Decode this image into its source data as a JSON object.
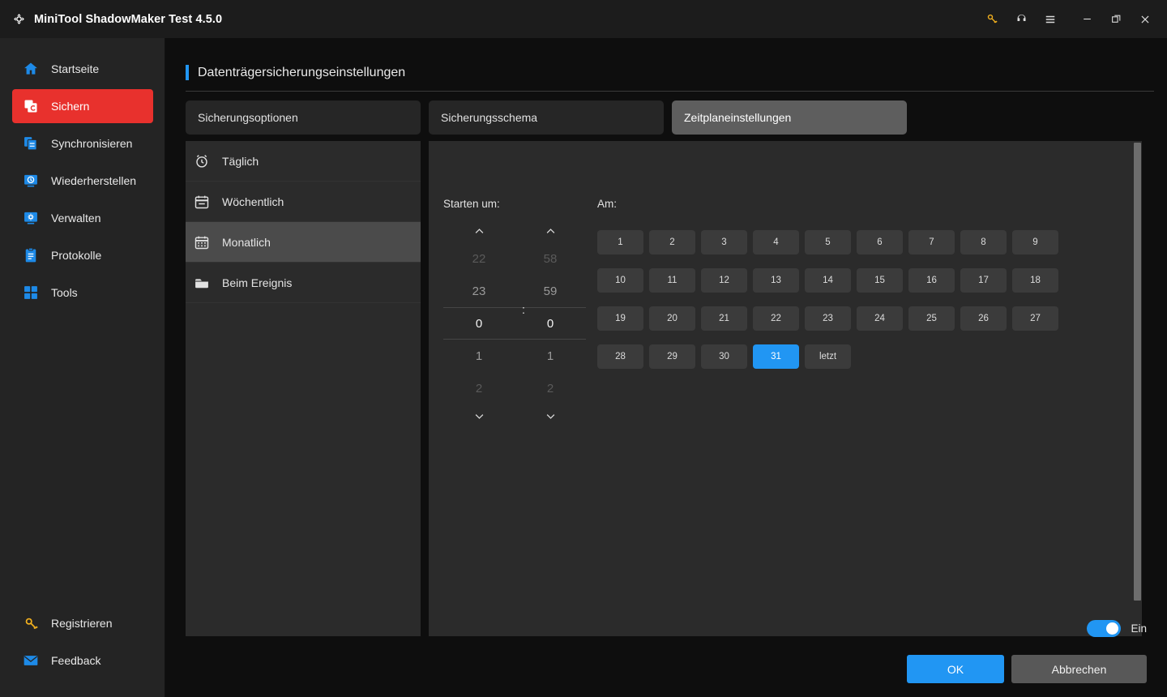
{
  "titlebar": {
    "title": "MiniTool ShadowMaker Test 4.5.0",
    "logo_icon": "shadowmaker-logo-icon",
    "actions": [
      {
        "name": "key-icon",
        "glyph": "key"
      },
      {
        "name": "headset-icon",
        "glyph": "headset"
      },
      {
        "name": "menu-icon",
        "glyph": "menu"
      },
      {
        "name": "minimize-icon",
        "glyph": "minimize"
      },
      {
        "name": "restore-icon",
        "glyph": "restore"
      },
      {
        "name": "close-icon",
        "glyph": "close"
      }
    ]
  },
  "sidebar": {
    "items": [
      {
        "label": "Startseite",
        "icon": "home-icon",
        "active": false
      },
      {
        "label": "Sichern",
        "icon": "backup-icon",
        "active": true
      },
      {
        "label": "Synchronisieren",
        "icon": "sync-icon",
        "active": false
      },
      {
        "label": "Wiederherstellen",
        "icon": "restore-monitor-icon",
        "active": false
      },
      {
        "label": "Verwalten",
        "icon": "manage-gear-monitor-icon",
        "active": false
      },
      {
        "label": "Protokolle",
        "icon": "logs-clipboard-icon",
        "active": false
      },
      {
        "label": "Tools",
        "icon": "tools-grid-icon",
        "active": false
      }
    ],
    "bottom_items": [
      {
        "label": "Registrieren",
        "icon": "key-icon"
      },
      {
        "label": "Feedback",
        "icon": "mail-icon"
      }
    ]
  },
  "main": {
    "page_title": "Datenträgersicherungseinstellungen",
    "accent_color": "#2196f3",
    "tabs": [
      {
        "label": "Sicherungsoptionen",
        "active": false
      },
      {
        "label": "Sicherungsschema",
        "active": false
      },
      {
        "label": "Zeitplaneinstellungen",
        "active": true
      }
    ],
    "schedule_types": [
      {
        "label": "Täglich",
        "icon": "alarm-clock-icon",
        "active": false
      },
      {
        "label": "Wöchentlich",
        "icon": "calendar-icon",
        "active": false
      },
      {
        "label": "Monatlich",
        "icon": "calendar-grid-icon",
        "active": true
      },
      {
        "label": "Beim Ereignis",
        "icon": "folder-icon",
        "active": false
      }
    ],
    "time_picker": {
      "label": "Starten um:",
      "separator": ":",
      "up_icon": "chevron-up-icon",
      "down_icon": "chevron-down-icon",
      "hours": {
        "above2": "22",
        "above1": "23",
        "selected": "0",
        "below1": "1",
        "below2": "2"
      },
      "minutes": {
        "above2": "58",
        "above1": "59",
        "selected": "0",
        "below1": "1",
        "below2": "2"
      }
    },
    "days": {
      "label": "Am:",
      "selected": "31",
      "items": [
        "1",
        "2",
        "3",
        "4",
        "5",
        "6",
        "7",
        "8",
        "9",
        "10",
        "11",
        "12",
        "13",
        "14",
        "15",
        "16",
        "17",
        "18",
        "19",
        "20",
        "21",
        "22",
        "23",
        "24",
        "25",
        "26",
        "27",
        "28",
        "29",
        "30",
        "31",
        "letzt"
      ]
    }
  },
  "footer": {
    "toggle": {
      "label": "Ein",
      "on": true,
      "color": "#2196f3"
    },
    "ok_label": "OK",
    "cancel_label": "Abbrechen"
  }
}
